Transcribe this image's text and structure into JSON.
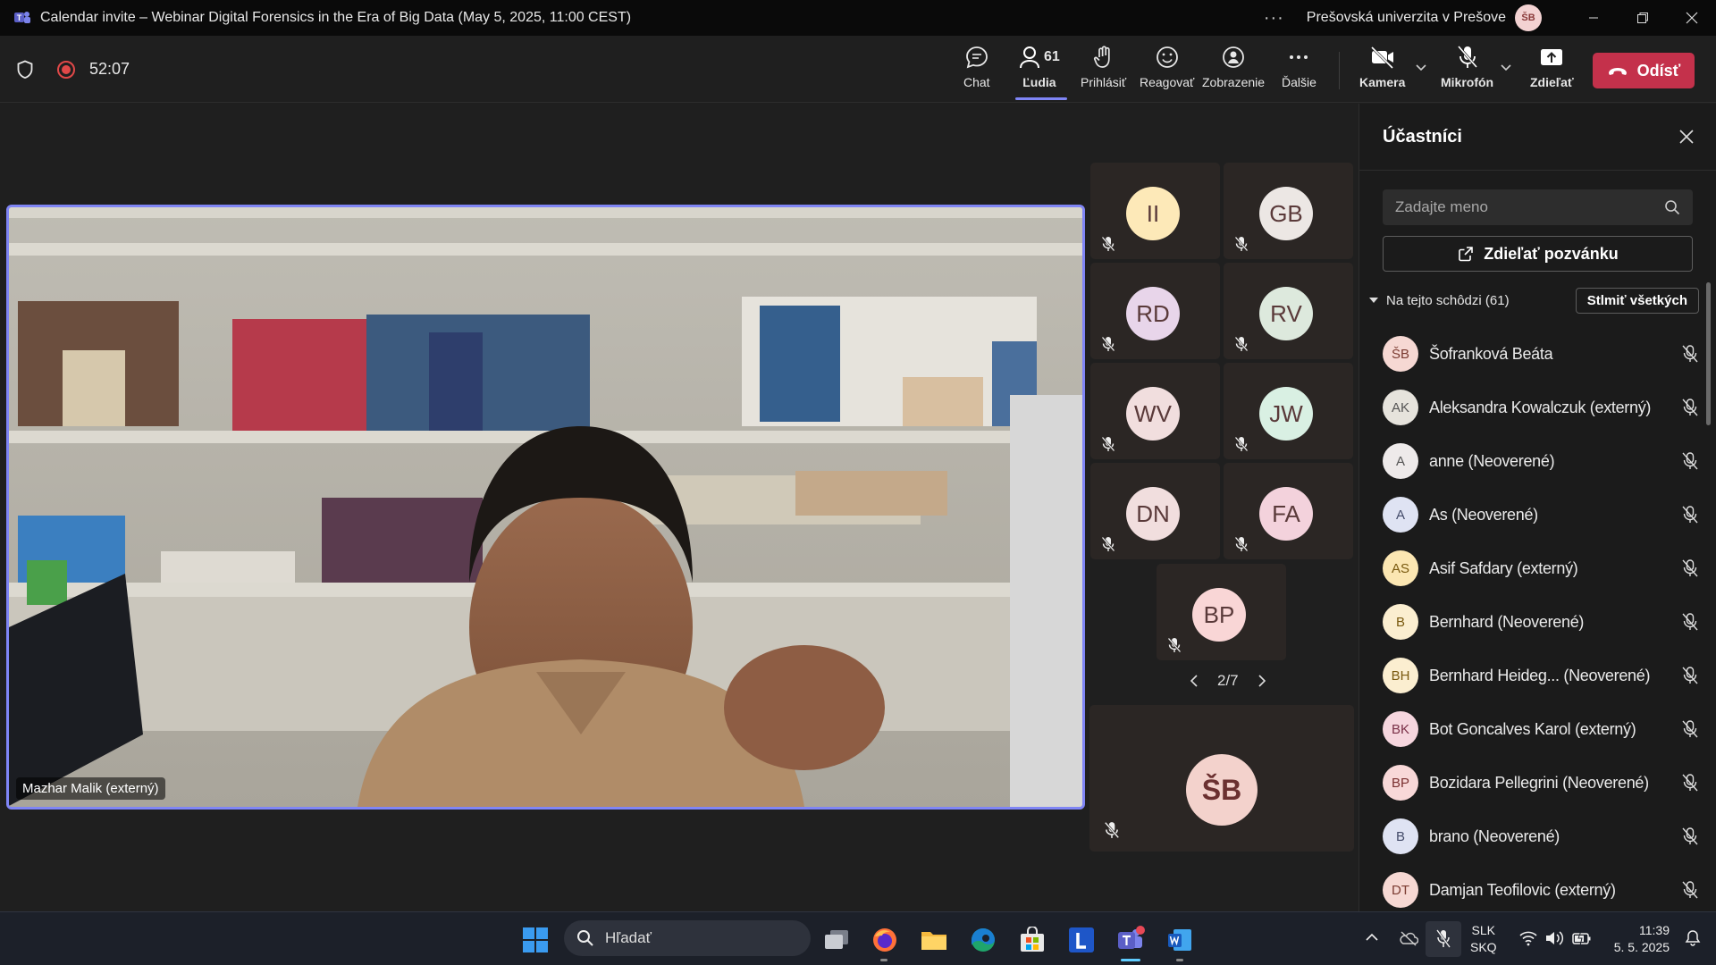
{
  "window": {
    "title": "Calendar invite – Webinar Digital Forensics in the Era of Big Data (May 5, 2025, 11:00 CEST)",
    "more": "···",
    "org_name": "Prešovská univerzita v Prešove",
    "org_avatar": "ŠB"
  },
  "toolbar": {
    "timer": "52:07",
    "chat": "Chat",
    "people": "Ľudia",
    "people_count": "61",
    "raise_hand": "Prihlásiť",
    "react": "Reagovať",
    "view": "Zobrazenie",
    "more": "Ďalšie",
    "camera": "Kamera",
    "mic": "Mikrofón",
    "share": "Zdieľať",
    "leave": "Odísť"
  },
  "stage": {
    "speaker_name": "Mazhar Malik (externý)",
    "page_indicator": "2/7",
    "tiles": [
      {
        "initials": "II",
        "color": "#fde9b8"
      },
      {
        "initials": "GB",
        "color": "#ece7e4"
      },
      {
        "initials": "RD",
        "color": "#e8d5ea"
      },
      {
        "initials": "RV",
        "color": "#dde9dd"
      },
      {
        "initials": "WV",
        "color": "#f1dede"
      },
      {
        "initials": "JW",
        "color": "#d9f0e3"
      },
      {
        "initials": "DN",
        "color": "#f1dede"
      },
      {
        "initials": "FA",
        "color": "#f3d2dc"
      },
      {
        "initials": "BP",
        "color": "#f9d6d6"
      }
    ],
    "self_initials": "ŠB"
  },
  "panel": {
    "title": "Účastníci",
    "search_placeholder": "Zadajte meno",
    "share_invite": "Zdieľať pozvánku",
    "section": "Na tejto schôdzi (61)",
    "mute_all": "Stlmiť všetkých",
    "participants": [
      {
        "initials": "ŠB",
        "name": "Šofranková Beáta",
        "color": "#f6d8d3"
      },
      {
        "initials": "AK",
        "name": "Aleksandra Kowalczuk (externý)",
        "color": "#e6e3dc"
      },
      {
        "initials": "A",
        "name": "anne (Neoverené)",
        "color": "#eeeaea"
      },
      {
        "initials": "A",
        "name": "As (Neoverené)",
        "color": "#dfe3f3"
      },
      {
        "initials": "AS",
        "name": "Asif Safdary (externý)",
        "color": "#fbe6b2"
      },
      {
        "initials": "B",
        "name": "Bernhard (Neoverené)",
        "color": "#fbeed0"
      },
      {
        "initials": "BH",
        "name": "Bernhard Heideg...  (Neoverené)",
        "color": "#fbeed0"
      },
      {
        "initials": "BK",
        "name": "Bot Goncalves Karol (externý)",
        "color": "#f6d6de"
      },
      {
        "initials": "BP",
        "name": "Bozidara Pellegrini (Neoverené)",
        "color": "#f8d8d8"
      },
      {
        "initials": "B",
        "name": "brano (Neoverené)",
        "color": "#dfe3f3"
      },
      {
        "initials": "DT",
        "name": "Damjan Teofilovic (externý)",
        "color": "#f6d8d3"
      }
    ]
  },
  "taskbar": {
    "search_placeholder": "Hľadať",
    "lang_top": "SLK",
    "lang_bottom": "SKQ",
    "time": "11:39",
    "date": "5. 5. 2025"
  },
  "colors": {
    "accent": "#7f85f5",
    "leave": "#c4314b",
    "record": "#e04848"
  }
}
